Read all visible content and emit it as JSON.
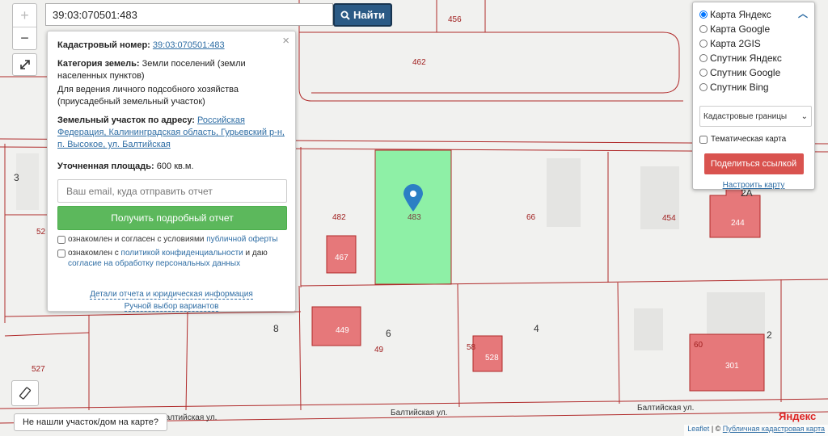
{
  "search": {
    "value": "39:03:070501:483",
    "button_label": "Найти"
  },
  "zoom": {
    "in_label": "+",
    "out_label": "−"
  },
  "info_panel": {
    "cadastral_label": "Кадастровый номер:",
    "cadastral_number": "39:03:070501:483",
    "category_label": "Категория земель:",
    "category_value": "Земли поселений (земли населенных пунктов)",
    "usage": "Для ведения личного подсобного хозяйства (приусадебный земельный участок)",
    "address_label": "Земельный участок по адресу:",
    "address_value": "Российская Федерация, Калининградская область, Гурьевский р-н, п. Высокое, ул. Балтийская",
    "area_label": "Уточненная площадь:",
    "area_value": "600 кв.м.",
    "email_placeholder": "Ваш email, куда отправить отчет",
    "report_button": "Получить подробный отчет",
    "agree1_text": "ознакомлен и согласен с условиями",
    "agree1_link": "публичной оферты",
    "agree2_text": "ознакомлен с",
    "agree2_link1": "политикой конфиденциальности",
    "agree2_mid": "и даю",
    "agree2_link2": "согласие на обработку персональных данных",
    "details_link": "Детали отчета и юридическая информация",
    "manual_link": "Ручной выбор вариантов",
    "close_label": "×"
  },
  "layers": {
    "options": [
      "Карта Яндекс",
      "Карта Google",
      "Карта 2GIS",
      "Спутник Яндекс",
      "Спутник Google",
      "Спутник Bing"
    ],
    "selected": "Карта Яндекс",
    "overlay_select": "Кадастровые границы",
    "thematic_label": "Тематическая карта",
    "share_button": "Поделиться ссылкой",
    "settings_link": "Настроить карту"
  },
  "map_labels": {
    "p456": "456",
    "p462": "462",
    "p482": "482",
    "p483": "483",
    "p467": "467",
    "p66": "66",
    "p454": "454",
    "p244": "244",
    "p2A": "2А",
    "p3": "3",
    "p52": "52",
    "p8": "8",
    "p6": "6",
    "p449": "449",
    "p49": "49",
    "p4": "4",
    "p58": "58",
    "p528": "528",
    "p60": "60",
    "p301": "301",
    "p527": "527",
    "p2": "2"
  },
  "streets": {
    "baltic1": "Балтийская ул.",
    "baltic2": "Балтийская ул.",
    "baltic3": "Балтийская ул."
  },
  "not_found": "Не нашли участок/дом на карте?",
  "attribution": {
    "leaflet": "Leaflet",
    "pkk": "Публичная кадастровая карта"
  },
  "yandex_logo": {
    "first": "Я",
    "rest": "ндекс"
  },
  "colors": {
    "selected_plot": "#8ef0a6",
    "building": "#e6787a",
    "boundary": "#b02a2a",
    "search_button": "#2b5a85",
    "report_button": "#5cb85c",
    "share_button": "#d9534f"
  }
}
